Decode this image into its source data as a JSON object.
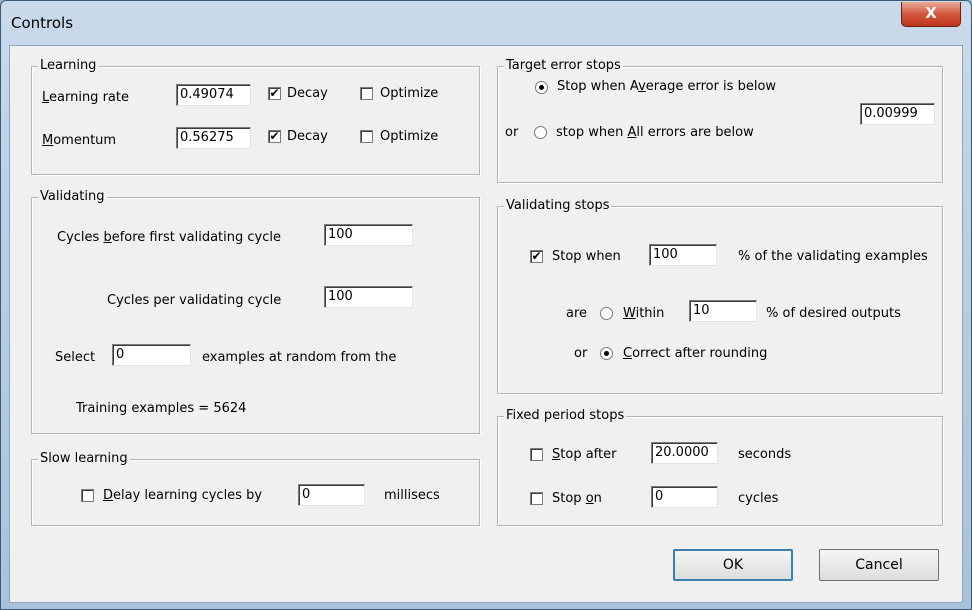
{
  "window": {
    "title": "Controls",
    "close_glyph": "X"
  },
  "learning": {
    "legend": "Learning",
    "rate_label_u": "L",
    "rate_label_rest": "earning rate",
    "rate_value": "0.49074",
    "momentum_label_u": "M",
    "momentum_label_rest": "omentum",
    "momentum_value": "0.56275",
    "decay_label": "Decay",
    "optimize_label": "Optimize"
  },
  "target_error": {
    "legend": "Target error stops",
    "average_pre": "Stop when A",
    "average_u": "v",
    "average_post": "erage error is below",
    "or": "or",
    "all_pre": "stop when ",
    "all_u": "A",
    "all_post": "ll errors are below",
    "value": "0.00999"
  },
  "validating": {
    "legend": "Validating",
    "first_pre": "Cycles ",
    "first_u": "b",
    "first_post": "efore first validating cycle",
    "first_value": "100",
    "per_label": "Cycles per validating cycle",
    "per_value": "100",
    "select_label": "Select",
    "select_value": "0",
    "select_post": "examples at random from the",
    "training_label": "Training examples = 5624"
  },
  "validating_stops": {
    "legend": "Validating stops",
    "stop_when": "Stop when",
    "stop_value": "100",
    "pct_text": "% of the validating examples",
    "are": "are",
    "within_u": "W",
    "within_rest": "ithin",
    "within_value": "10",
    "within_post": "% of desired outputs",
    "or": "or",
    "correct_u": "C",
    "correct_rest": "orrect after rounding"
  },
  "slow_learning": {
    "legend": "Slow learning",
    "delay_u": "D",
    "delay_rest": "elay learning cycles by",
    "delay_value": "0",
    "unit": "millisecs"
  },
  "fixed_period": {
    "legend": "Fixed period stops",
    "after_u": "S",
    "after_rest": "top after",
    "after_value": "20.0000",
    "after_unit": "seconds",
    "on_pre": "Stop ",
    "on_u": "o",
    "on_post": "n",
    "on_value": "0",
    "on_unit": "cycles"
  },
  "buttons": {
    "ok": "OK",
    "cancel": "Cancel"
  },
  "check_glyph": "✔"
}
